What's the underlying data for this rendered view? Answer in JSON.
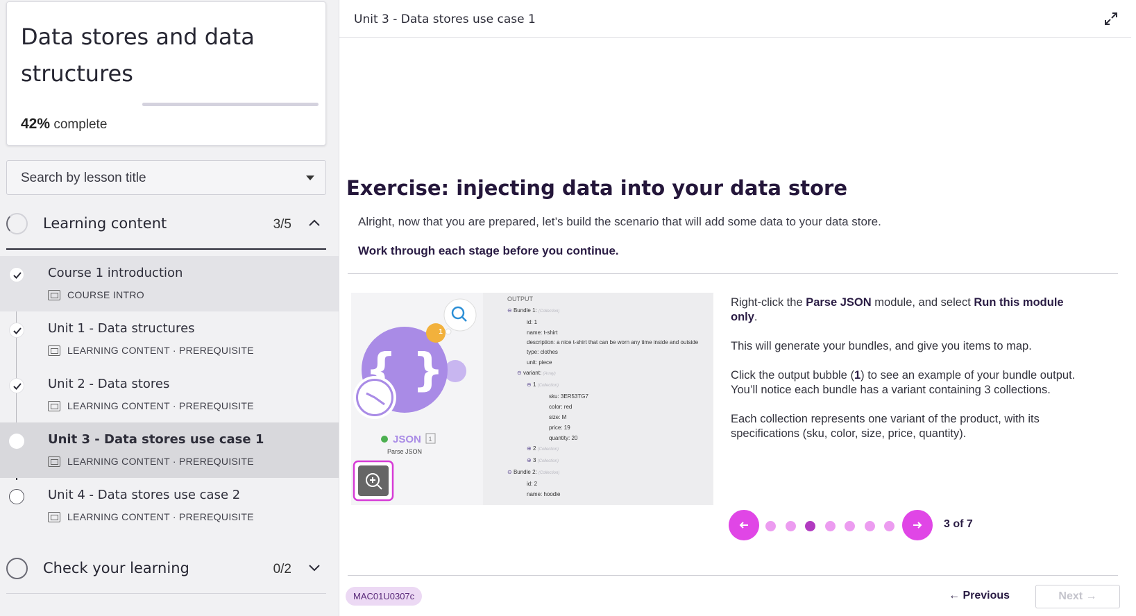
{
  "course": {
    "title": "Data stores and data structures",
    "progress_percent": 42,
    "progress_value": "42%",
    "progress_suffix": "complete"
  },
  "search": {
    "placeholder": "Search by lesson title"
  },
  "sections": [
    {
      "title": "Learning content",
      "count": "3/5",
      "expanded": true,
      "lessons": [
        {
          "title": "Course 1 introduction",
          "meta": "COURSE INTRO",
          "status": "done",
          "icon": "document-icon"
        },
        {
          "title": "Unit 1 - Data structures",
          "meta": "LEARNING CONTENT · PREREQUISITE",
          "status": "done",
          "icon": "media-icon"
        },
        {
          "title": "Unit 2 - Data stores",
          "meta": "LEARNING CONTENT · PREREQUISITE",
          "status": "done",
          "icon": "media-icon"
        },
        {
          "title": "Unit 3 - Data stores use case 1",
          "meta": "LEARNING CONTENT · PREREQUISITE",
          "status": "current",
          "icon": "media-icon"
        },
        {
          "title": "Unit 4 - Data stores use case 2",
          "meta": "LEARNING CONTENT · PREREQUISITE",
          "status": "todo",
          "icon": "media-icon"
        }
      ]
    },
    {
      "title": "Check your learning",
      "count": "0/2",
      "expanded": false
    }
  ],
  "main": {
    "header_title": "Unit 3 - Data stores use case 1",
    "heading": "Exercise: injecting data into your data store",
    "intro": "Alright, now that you are prepared, let’s build the scenario that will add some data to your data store.",
    "instruction": "Work through each stage before you continue.",
    "image": {
      "module_label": "JSON",
      "module_sub": "Parse JSON",
      "module_badge": "1",
      "bubble_count": "1",
      "output_label": "OUTPUT",
      "tree": [
        "Bundle 1:",
        "id: 1",
        "name: t-shirt",
        "description: a nice t-shirt that can be worn any time inside and outside",
        "type: clothes",
        "unit: piece",
        "variant:",
        "1",
        "sku: 3ER53TG7",
        "color: red",
        "size: M",
        "price: 19",
        "quantity: 20",
        "2",
        "3",
        "Bundle 2:",
        "id: 2",
        "name: hoodie"
      ]
    },
    "caption": {
      "p1_a": "Right-click the ",
      "p1_b": "Parse JSON",
      "p1_c": " module, and select ",
      "p1_d": "Run this module only",
      "p1_e": ".",
      "p2": "This will generate your bundles, and give you items to map.",
      "p3_a": "Click the output bubble (",
      "p3_b": "1",
      "p3_c": ") to see an example of your bundle output. You’ll notice each bundle has a variant containing 3 collections.",
      "p4": "Each collection represents one variant of the product, with its specifications (sku, color, size, price, quantity)."
    },
    "carousel": {
      "current": 3,
      "total": 7,
      "label": "3 of 7"
    },
    "code": "MAC01U0307c",
    "prev_label": "Previous",
    "next_label": "Next"
  },
  "colors": {
    "accent": "#e046e6",
    "accent_dark": "#b13ac0",
    "heading": "#24163a",
    "module": "#a98be6"
  }
}
